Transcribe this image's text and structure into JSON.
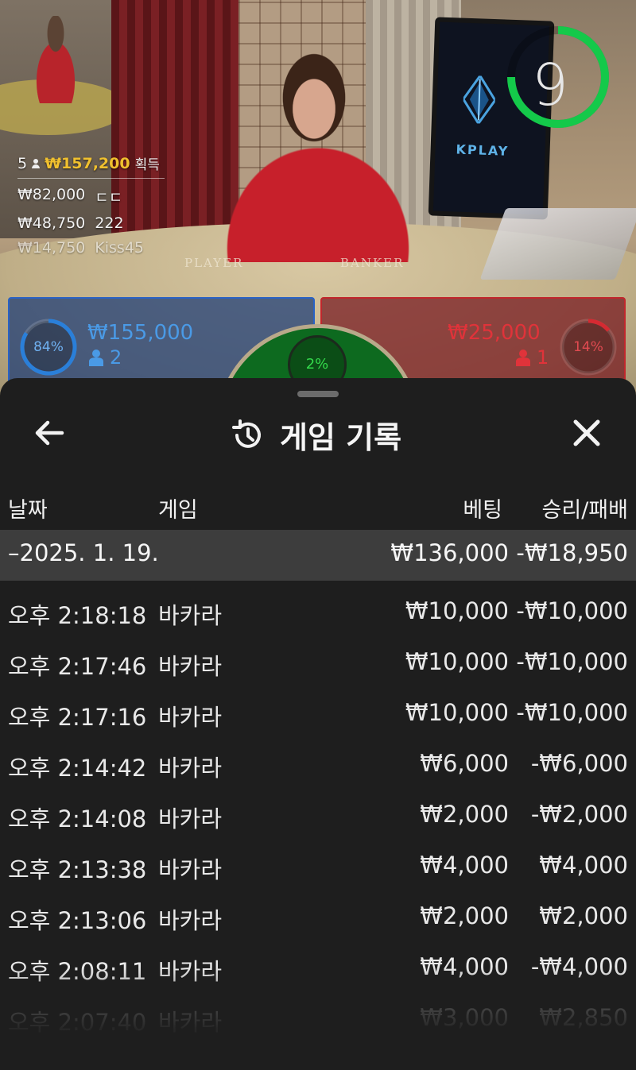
{
  "stream": {
    "timer": "9",
    "brand": "KPLAY",
    "table_labels": {
      "player": "PLAYER",
      "banker": "BANKER"
    },
    "winners": {
      "count": "5",
      "total": "₩157,200",
      "total_suffix": "획득",
      "entries": [
        {
          "amount": "₩82,000",
          "name": "ㄷㄷ"
        },
        {
          "amount": "₩48,750",
          "name": "222"
        },
        {
          "amount": "₩14,750",
          "name": "Kiss45"
        }
      ]
    },
    "bets": {
      "player": {
        "percent": "84%",
        "amount": "₩155,000",
        "players": "2",
        "fill": 0.84
      },
      "tie": {
        "percent": "2%",
        "fill": 0.02
      },
      "banker": {
        "percent": "14%",
        "amount": "₩25,000",
        "players": "1",
        "fill": 0.14
      }
    },
    "colors": {
      "player": "#2a7fd9",
      "banker": "#d52a32",
      "tie": "#1fbf3a",
      "timer": "#14c94a",
      "winner_amount": "#f0c02e"
    }
  },
  "history": {
    "title": "게임 기록",
    "icons": {
      "back": "arrow-left-icon",
      "title": "history-icon",
      "close": "close-icon"
    },
    "columns": {
      "date": "날짜",
      "game": "게임",
      "bet": "베팅",
      "result": "승리/패배"
    },
    "date_group": {
      "label": "–2025. 1. 19.",
      "bet_total": "₩136,000",
      "result_total": "-₩18,950"
    },
    "rows": [
      {
        "time": "오후 2:18:18",
        "game": "바카라",
        "bet": "₩10,000",
        "result": "-₩10,000"
      },
      {
        "time": "오후 2:17:46",
        "game": "바카라",
        "bet": "₩10,000",
        "result": "-₩10,000"
      },
      {
        "time": "오후 2:17:16",
        "game": "바카라",
        "bet": "₩10,000",
        "result": "-₩10,000"
      },
      {
        "time": "오후 2:14:42",
        "game": "바카라",
        "bet": "₩6,000",
        "result": "-₩6,000"
      },
      {
        "time": "오후 2:14:08",
        "game": "바카라",
        "bet": "₩2,000",
        "result": "-₩2,000"
      },
      {
        "time": "오후 2:13:38",
        "game": "바카라",
        "bet": "₩4,000",
        "result": "₩4,000"
      },
      {
        "time": "오후 2:13:06",
        "game": "바카라",
        "bet": "₩2,000",
        "result": "₩2,000"
      },
      {
        "time": "오후 2:08:11",
        "game": "바카라",
        "bet": "₩4,000",
        "result": "-₩4,000"
      },
      {
        "time": "오후 2:07:40",
        "game": "바카라",
        "bet": "₩3,000",
        "result": "₩2,850"
      }
    ]
  }
}
